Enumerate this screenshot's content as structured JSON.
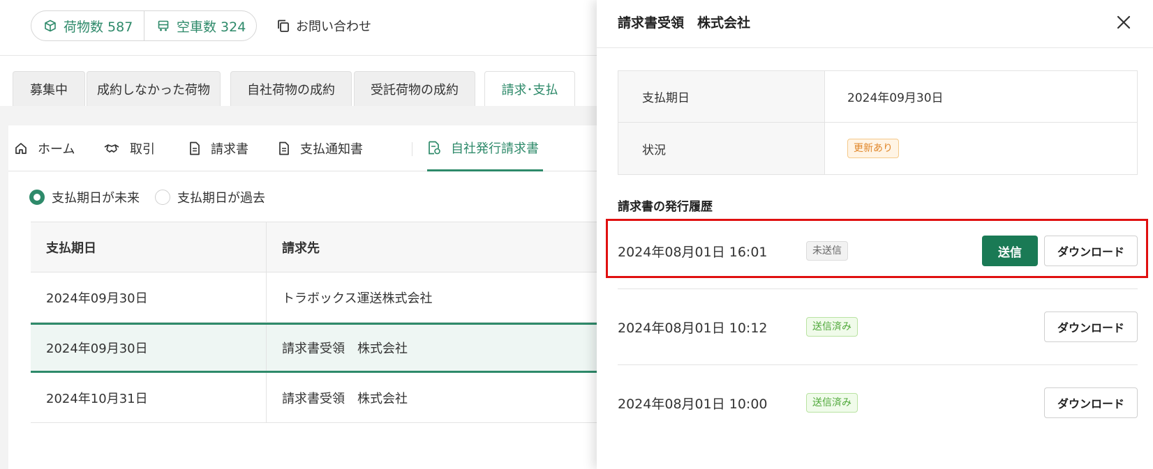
{
  "header": {
    "cargo_stat": "荷物数 587",
    "truck_stat": "空車数 324",
    "contact_label": "お問い合わせ"
  },
  "tabs": [
    {
      "label": "募集中"
    },
    {
      "label": "成約しなかった荷物"
    },
    {
      "label": "自社荷物の成約"
    },
    {
      "label": "受託荷物の成約"
    },
    {
      "label": "請求･支払",
      "active": true
    }
  ],
  "subnav": [
    {
      "label": "ホーム",
      "icon": "home-icon"
    },
    {
      "label": "取引",
      "icon": "handshake-icon"
    },
    {
      "label": "請求書",
      "icon": "document-icon"
    },
    {
      "label": "支払通知書",
      "icon": "document-icon"
    },
    {
      "label": "自社発行請求書",
      "icon": "invoice-icon",
      "active": true
    }
  ],
  "filter": {
    "option_future": "支払期日が未来",
    "option_past": "支払期日が過去",
    "selected": "支払期日が未来"
  },
  "table": {
    "headers": [
      "支払期日",
      "請求先"
    ],
    "rows": [
      {
        "due": "2024年09月30日",
        "client": "トラボックス運送株式会社"
      },
      {
        "due": "2024年09月30日",
        "client": "請求書受領　株式会社",
        "selected": true
      },
      {
        "due": "2024年10月31日",
        "client": "請求書受領　株式会社"
      }
    ]
  },
  "drawer": {
    "title": "請求書受領　株式会社",
    "info": [
      {
        "label": "支払期日",
        "value": "2024年09月30日"
      },
      {
        "label": "状況",
        "badge": "更新あり"
      }
    ],
    "history_title": "請求書の発行履歴",
    "history": [
      {
        "datetime": "2024年08月01日 16:01",
        "status": "未送信",
        "send_label": "送信",
        "download_label": "ダウンロード"
      },
      {
        "datetime": "2024年08月01日 10:12",
        "status": "送信済み",
        "download_label": "ダウンロード"
      },
      {
        "datetime": "2024年08月01日 10:00",
        "status": "送信済み",
        "download_label": "ダウンロード"
      }
    ]
  },
  "colors": {
    "accent": "#2e8a6a",
    "send_button": "#1a7a55",
    "highlight": "#e01010",
    "badge_update": "#e0872b",
    "badge_sent": "#4fa83a"
  }
}
